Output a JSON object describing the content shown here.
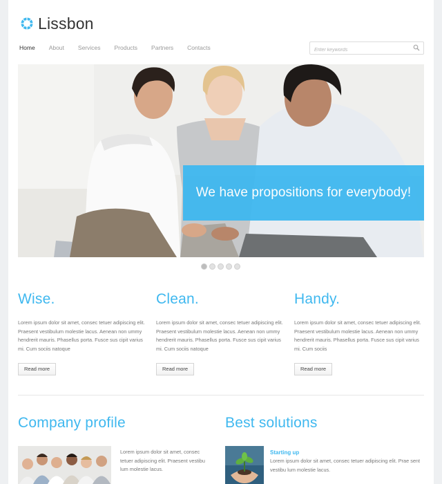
{
  "brand": {
    "name": "Lissbon",
    "accent": "#3fb8ef"
  },
  "nav": {
    "items": [
      {
        "label": "Home",
        "active": true
      },
      {
        "label": "About",
        "active": false
      },
      {
        "label": "Services",
        "active": false
      },
      {
        "label": "Products",
        "active": false
      },
      {
        "label": "Partners",
        "active": false
      },
      {
        "label": "Contacts",
        "active": false
      }
    ]
  },
  "search": {
    "placeholder": "Enter keywords",
    "value": "",
    "icon": "search-icon"
  },
  "slider": {
    "caption": "We have propositions for everybody!",
    "dots": 5,
    "active_dot": 1
  },
  "features": [
    {
      "title": "Wise.",
      "text": "Lorem ipsum dolor sit amet, consec tetuer adipiscing elit. Praesent vestibulum molestie lacus. Aenean non ummy hendrerit mauris. Phasellus porta. Fusce sus cipit varius mi. Cum sociis natoque",
      "button": "Read more"
    },
    {
      "title": "Clean.",
      "text": "Lorem ipsum dolor sit amet, consec tetuer adipiscing elit. Praesent vestibulum molestie lacus. Aenean non ummy hendrerit mauris. Phasellus porta. Fusce sus cipit varius mi. Cum sociis natoque",
      "button": "Read more"
    },
    {
      "title": "Handy.",
      "text": "Lorem ipsum dolor sit amet, consec tetuer adipiscing elit. Praesent vestibulum molestie lacus. Aenean non ummy hendrerit mauris. Phasellus porta. Fusce sus cipit varius mi. Cum sociis",
      "button": "Read more"
    }
  ],
  "profile": {
    "title": "Company profile",
    "text": "Lorem ipsum dolor sit amet, consec tetuer adipiscing elit. Praesent vestibu lum molestie lacus."
  },
  "solutions": {
    "title": "Best solutions",
    "subtitle": "Starting up",
    "text": "Lorem ipsum dolor sit amet, consec tetuer adipiscing elit. Prae sent vestibu lum molestie lacus."
  }
}
